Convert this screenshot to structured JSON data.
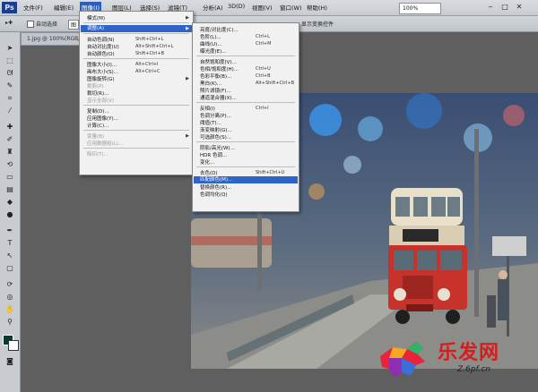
{
  "app": {
    "logo": "Ps",
    "zoom": "100%"
  },
  "menubar": [
    {
      "label": "文件(F)"
    },
    {
      "label": "编辑(E)"
    },
    {
      "label": "图像(I)",
      "active": true
    },
    {
      "label": "图层(L)"
    },
    {
      "label": "选择(S)"
    },
    {
      "label": "滤镜(T)"
    },
    {
      "label": "分析(A)"
    },
    {
      "label": "3D(D)"
    },
    {
      "label": "视图(V)"
    },
    {
      "label": "窗口(W)"
    },
    {
      "label": "帮助(H)"
    }
  ],
  "options_bar": {
    "auto_select_label": "自动选择",
    "layer_label": "图",
    "transform_label": "显示变换控件"
  },
  "document": {
    "tab_title": "1.jpg @ 100%(RGB/8)"
  },
  "image_menu": {
    "items": [
      {
        "label": "模式(M)",
        "shortcut": "",
        "submenu": true,
        "disabled": false,
        "highlighted": false
      },
      {
        "sep": true
      },
      {
        "label": "调整(A)",
        "shortcut": "",
        "submenu": true,
        "disabled": false,
        "highlighted": true
      },
      {
        "sep": true
      },
      {
        "label": "自动色调(N)",
        "shortcut": "Shift+Ctrl+L",
        "disabled": false
      },
      {
        "label": "自动对比度(U)",
        "shortcut": "Alt+Shift+Ctrl+L",
        "disabled": false
      },
      {
        "label": "自动颜色(O)",
        "shortcut": "Shift+Ctrl+B",
        "disabled": false
      },
      {
        "sep": true
      },
      {
        "label": "图像大小(I)...",
        "shortcut": "Alt+Ctrl+I",
        "disabled": false
      },
      {
        "label": "画布大小(S)...",
        "shortcut": "Alt+Ctrl+C",
        "disabled": false
      },
      {
        "label": "图像旋转(G)",
        "shortcut": "",
        "submenu": true,
        "disabled": false
      },
      {
        "label": "裁剪(P)",
        "shortcut": "",
        "disabled": true
      },
      {
        "label": "裁切(R)...",
        "shortcut": "",
        "disabled": false
      },
      {
        "label": "显示全部(V)",
        "shortcut": "",
        "disabled": true
      },
      {
        "sep": true
      },
      {
        "label": "复制(D)...",
        "shortcut": "",
        "disabled": false
      },
      {
        "label": "应用图像(Y)...",
        "shortcut": "",
        "disabled": false
      },
      {
        "label": "计算(C)...",
        "shortcut": "",
        "disabled": false
      },
      {
        "sep": true
      },
      {
        "label": "变量(B)",
        "shortcut": "",
        "submenu": true,
        "disabled": true
      },
      {
        "label": "应用数据组(L)...",
        "shortcut": "",
        "disabled": true
      },
      {
        "sep": true
      },
      {
        "label": "陷印(T)...",
        "shortcut": "",
        "disabled": true
      }
    ]
  },
  "adjust_menu": {
    "items": [
      {
        "label": "亮度/对比度(C)...",
        "shortcut": ""
      },
      {
        "label": "色阶(L)...",
        "shortcut": "Ctrl+L"
      },
      {
        "label": "曲线(U)...",
        "shortcut": "Ctrl+M"
      },
      {
        "label": "曝光度(E)...",
        "shortcut": ""
      },
      {
        "sep": true
      },
      {
        "label": "自然饱和度(V)...",
        "shortcut": ""
      },
      {
        "label": "色相/饱和度(H)...",
        "shortcut": "Ctrl+U"
      },
      {
        "label": "色彩平衡(B)...",
        "shortcut": "Ctrl+B"
      },
      {
        "label": "黑白(K)...",
        "shortcut": "Alt+Shift+Ctrl+B"
      },
      {
        "label": "照片滤镜(F)...",
        "shortcut": ""
      },
      {
        "label": "通道混合器(X)...",
        "shortcut": ""
      },
      {
        "sep": true
      },
      {
        "label": "反相(I)",
        "shortcut": "Ctrl+I"
      },
      {
        "label": "色调分离(P)...",
        "shortcut": ""
      },
      {
        "label": "阈值(T)...",
        "shortcut": ""
      },
      {
        "label": "渐变映射(G)...",
        "shortcut": ""
      },
      {
        "label": "可选颜色(S)...",
        "shortcut": ""
      },
      {
        "sep": true
      },
      {
        "label": "阴影/高光(W)...",
        "shortcut": ""
      },
      {
        "label": "HDR 色调...",
        "shortcut": ""
      },
      {
        "label": "变化...",
        "shortcut": ""
      },
      {
        "sep": true
      },
      {
        "label": "去色(D)",
        "shortcut": "Shift+Ctrl+U"
      },
      {
        "label": "匹配颜色(M)...",
        "shortcut": "",
        "highlighted": true
      },
      {
        "label": "替换颜色(R)...",
        "shortcut": ""
      },
      {
        "label": "色调均化(Q)",
        "shortcut": ""
      }
    ]
  },
  "watermark": {
    "brand_text": "乐发网",
    "url_text": "Z.6pf.cn"
  },
  "colors": {
    "menu_highlight": "#2e63c8",
    "foreground_swatch": "#0b3a2e"
  }
}
